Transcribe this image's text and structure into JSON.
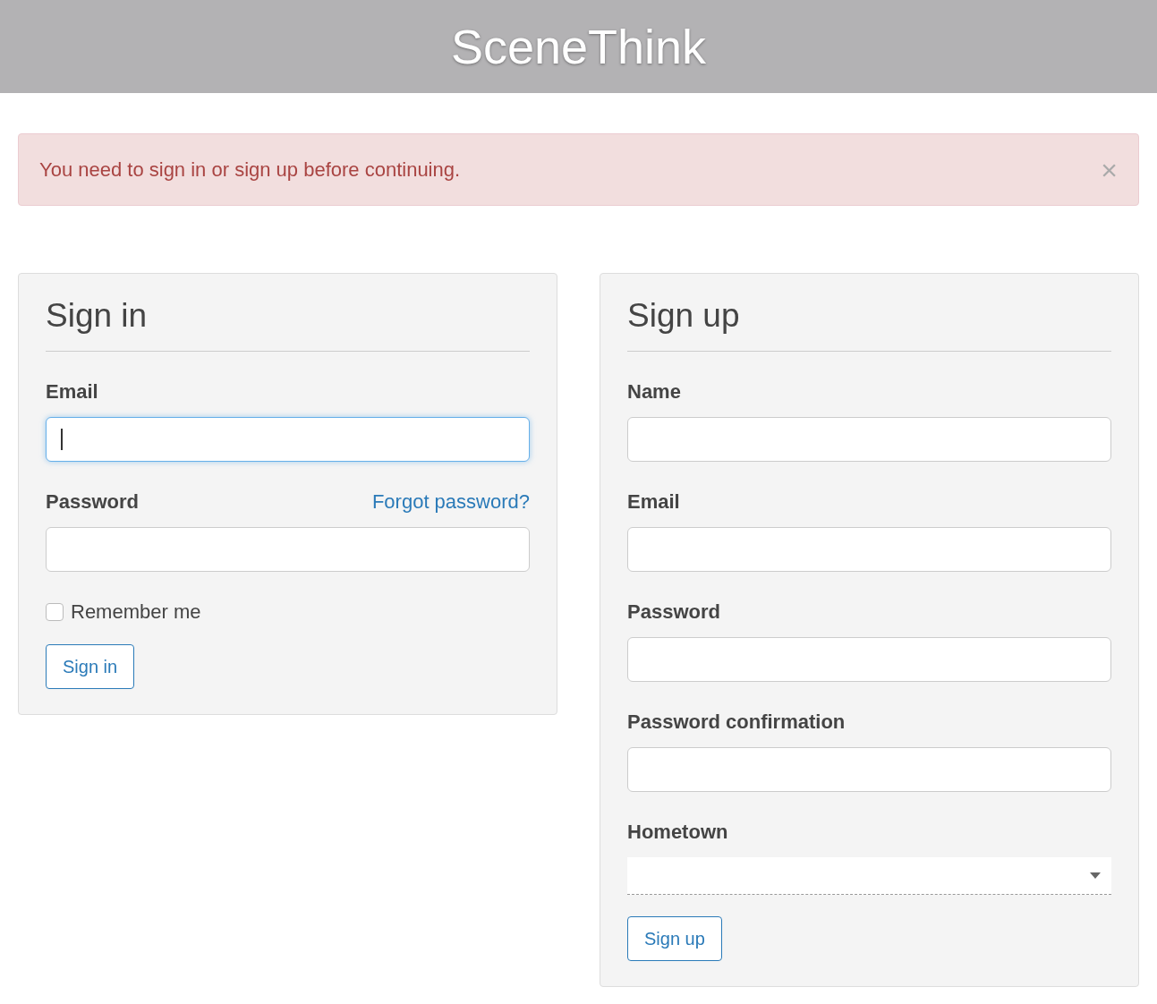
{
  "header": {
    "title": "SceneThink"
  },
  "alert": {
    "message": "You need to sign in or sign up before continuing.",
    "close": "×"
  },
  "sign_in": {
    "title": "Sign in",
    "fields": [
      {
        "label": "Email",
        "focused": true
      },
      {
        "label": "Password",
        "focused": false,
        "link": "Forgot password?"
      }
    ],
    "remember": {
      "label": "Remember me",
      "checked": false
    },
    "button": "Sign in"
  },
  "sign_up": {
    "title": "Sign up",
    "fields": [
      {
        "label": "Name",
        "kind": "text"
      },
      {
        "label": "Email",
        "kind": "text"
      },
      {
        "label": "Password",
        "kind": "text"
      },
      {
        "label": "Password confirmation",
        "kind": "text"
      },
      {
        "label": "Hometown",
        "kind": "select"
      }
    ],
    "button": "Sign up"
  }
}
